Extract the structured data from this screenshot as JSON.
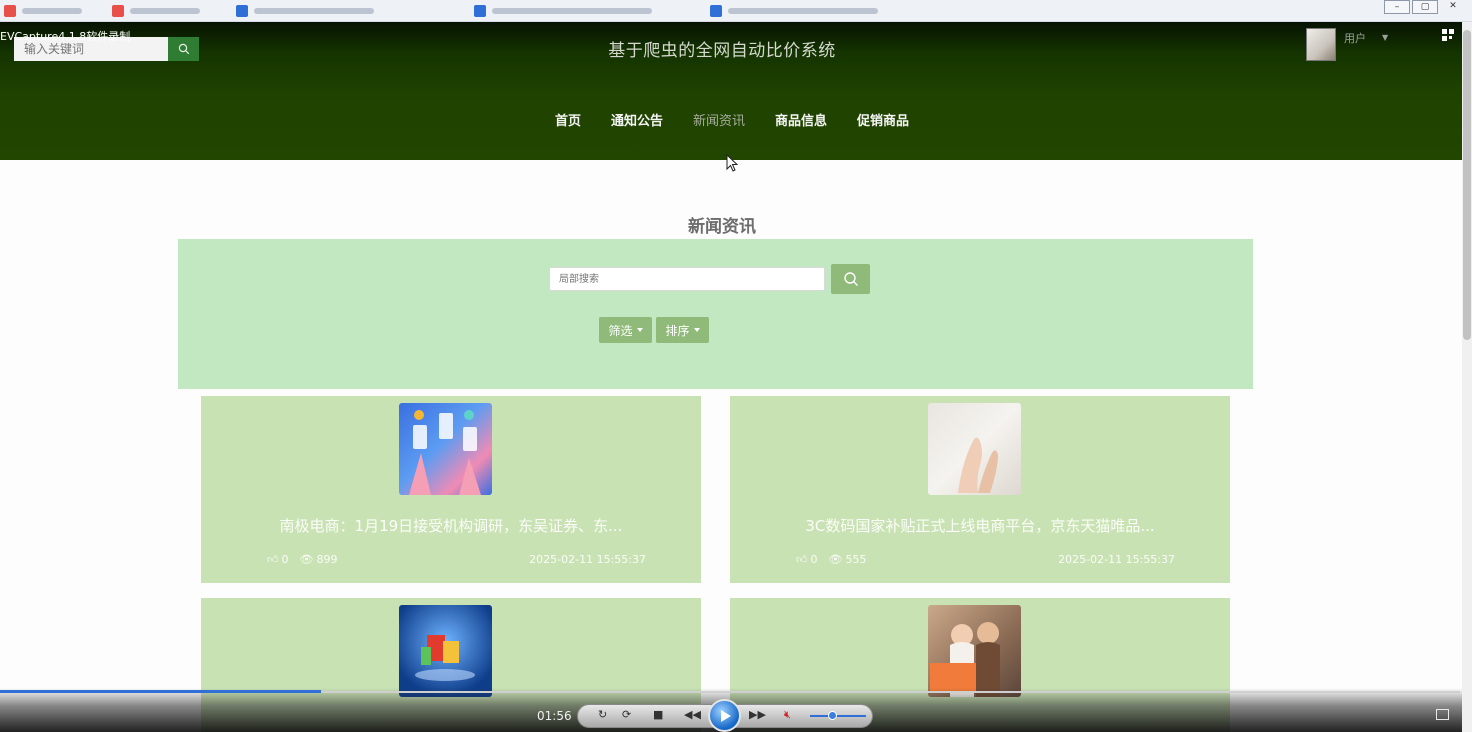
{
  "recorder": {
    "watermark": "EVCapture4.1.8软件录制"
  },
  "header": {
    "keyword_placeholder": "输入关键词",
    "site_title": "基于爬虫的全网自动比价系统",
    "user_label": "用户",
    "nav": [
      "首页",
      "通知公告",
      "新闻资讯",
      "商品信息",
      "促销商品"
    ],
    "nav_active": 2
  },
  "main": {
    "section_title": "新闻资讯",
    "search_placeholder": "局部搜索",
    "filter_label": "筛选",
    "sort_label": "排序"
  },
  "cards": [
    {
      "title": "南极电商：1月19日接受机构调研，东吴证券、东...",
      "likes": "0",
      "views": "899",
      "date": "2025-02-11 15:55:37",
      "thumb_icon": "phones-hands-image"
    },
    {
      "title": "3C数码国家补贴正式上线电商平台，京东天猫唯品...",
      "likes": "0",
      "views": "555",
      "date": "2025-02-11 15:55:37",
      "thumb_icon": "hand-gesture-image"
    },
    {
      "title": "",
      "likes": "",
      "views": "",
      "date": "",
      "thumb_icon": "shopping-bags-image"
    },
    {
      "title": "",
      "likes": "",
      "views": "",
      "date": "",
      "thumb_icon": "couple-shopping-image"
    }
  ],
  "player": {
    "time": "01:56",
    "progress_pct": 22,
    "volume_pct": 40
  },
  "colors": {
    "header_bg": "#224600",
    "panel_bg": "#c1e8c0",
    "card_bg": "#c9e2b4",
    "button": "#8fba79"
  }
}
